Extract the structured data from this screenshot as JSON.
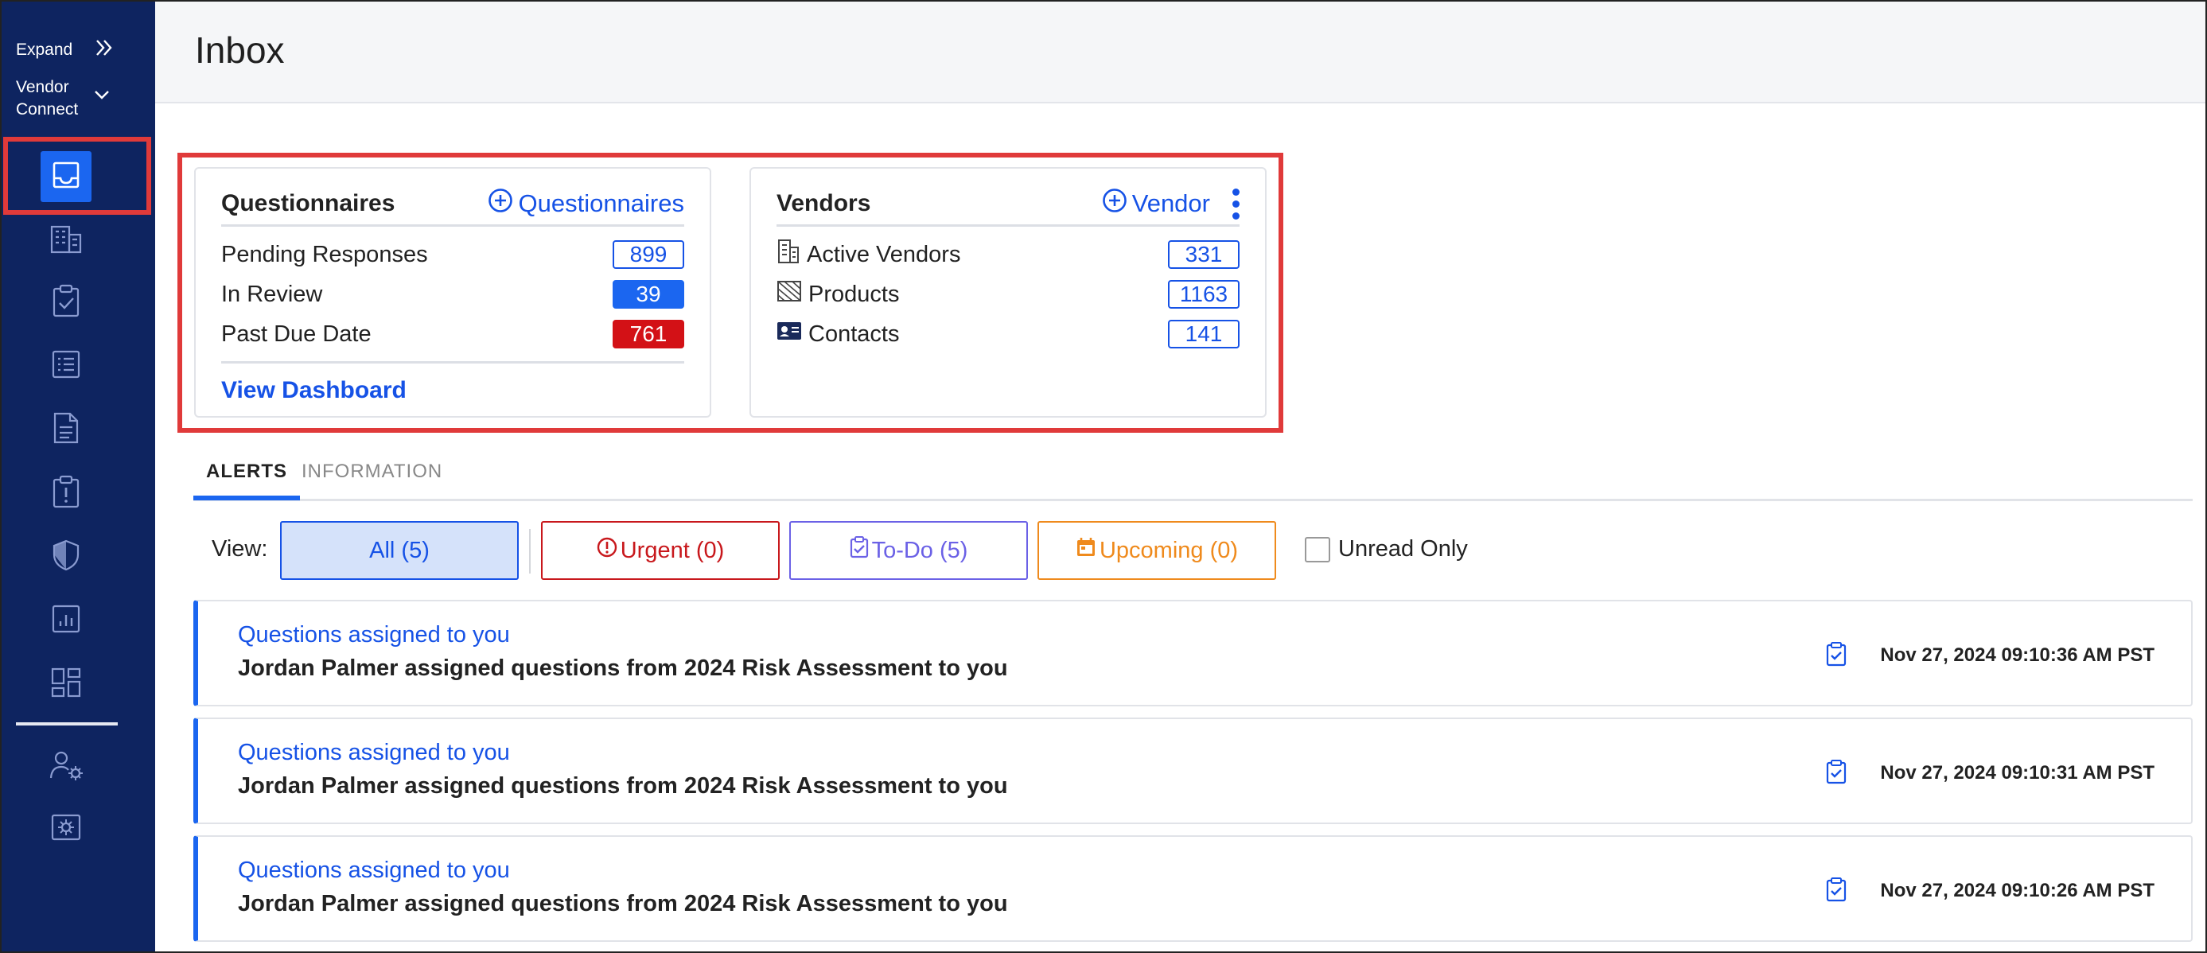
{
  "sidebar": {
    "expand_label": "Expand",
    "vendor_connect_label": "Vendor Connect",
    "icons": [
      "inbox-icon",
      "building-icon",
      "clipboard-check-icon",
      "list-icon",
      "document-icon",
      "clipboard-alert-icon",
      "shield-icon",
      "report-chart-icon",
      "dashboard-grid-icon",
      "user-settings-icon",
      "settings-box-icon"
    ]
  },
  "header": {
    "title": "Inbox"
  },
  "questionnaires": {
    "title": "Questionnaires",
    "add_label": "Questionnaires",
    "rows": [
      {
        "label": "Pending Responses",
        "value": "899"
      },
      {
        "label": "In Review",
        "value": "39"
      },
      {
        "label": "Past Due Date",
        "value": "761"
      }
    ],
    "link": "View Dashboard"
  },
  "vendors": {
    "title": "Vendors",
    "add_label": "Vendor",
    "rows": [
      {
        "label": "Active Vendors",
        "value": "331"
      },
      {
        "label": "Products",
        "value": "1163"
      },
      {
        "label": "Contacts",
        "value": "141"
      }
    ]
  },
  "tabs": {
    "alerts": "ALERTS",
    "information": "INFORMATION"
  },
  "filters": {
    "view_label": "View:",
    "all": "All (5)",
    "urgent": "Urgent (0)",
    "todo": "To-Do (5)",
    "upcoming": "Upcoming (0)",
    "unread_only": "Unread Only"
  },
  "alerts": [
    {
      "title": "Questions assigned to you",
      "body": "Jordan Palmer assigned questions from 2024 Risk Assessment to you",
      "time": "Nov 27, 2024 09:10:36 AM PST"
    },
    {
      "title": "Questions assigned to you",
      "body": "Jordan Palmer assigned questions from 2024 Risk Assessment to you",
      "time": "Nov 27, 2024 09:10:31 AM PST"
    },
    {
      "title": "Questions assigned to you",
      "body": "Jordan Palmer assigned questions from 2024 Risk Assessment to you",
      "time": "Nov 27, 2024 09:10:26 AM PST"
    }
  ],
  "colors": {
    "sidebar_bg": "#0e2460",
    "accent": "#1b66f0",
    "urgent": "#c8181c",
    "todo": "#6b61e6",
    "upcoming": "#ef8a1c",
    "highlight": "#e03a3a"
  }
}
